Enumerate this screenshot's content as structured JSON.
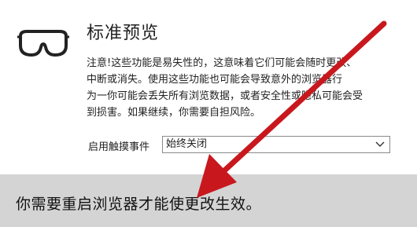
{
  "page": {
    "title": "标准预览",
    "warning_line1": "注意!这些功能是易失性的，这意味着它们可能会随时更改、",
    "warning_line2": "中断或消失。使用这些功能也可能会导致意外的浏览器行",
    "warning_line3": "为一你可能会丢失所有浏览数据，或者安全性或隐私可能会受",
    "warning_line4": "到损害。如果继续，你需要自担风险。",
    "touch_events_label": "启用触摸事件",
    "touch_events_value": "始终关闭",
    "restart_notice": "你需要重启浏览器才能使更改生效。"
  },
  "icons": {
    "header_icon": "goggles-icon",
    "select_chevron": "chevron-down-icon",
    "annotation": "arrow-annotation"
  },
  "colors": {
    "footer_bg": "#d4d4d4",
    "arrow": "#c8181e"
  }
}
